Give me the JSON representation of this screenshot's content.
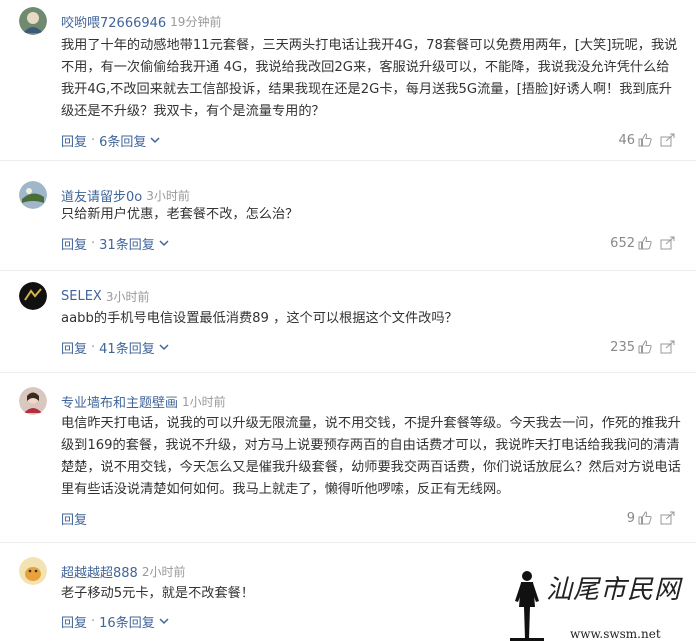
{
  "comments": [
    {
      "user": "咬哟喂72666946",
      "time": "19分钟前",
      "text": "我用了十年的动感地带11元套餐，三天两头打电话让我开4G，78套餐可以免费用两年，[大笑]玩呢，我说不用，有一次偷偷给我开通 4G，我说给我改回2G来，客服说升级可以，不能降，我说我没允许凭什么给我开4G,不改回来就去工信部投诉，结果我现在还是2G卡，每月送我5G流量，[捂脸]好诱人啊！我到底升级还是不升级？我双卡，有个是流量专用的？",
      "reply": "回复",
      "replies": "6条回复",
      "likes": "46"
    },
    {
      "user": "道友请留步0o",
      "time": "3小时前",
      "text": "只给新用户优惠，老套餐不改，怎么治？",
      "reply": "回复",
      "replies": "31条回复",
      "likes": "652"
    },
    {
      "user": "SELEX",
      "time": "3小时前",
      "text": "aabb的手机号电信设置最低消费89 ，这个可以根据这个文件改吗？",
      "reply": "回复",
      "replies": "41条回复",
      "likes": "235"
    },
    {
      "user": "专业墙布和主题壁画",
      "time": "1小时前",
      "text": "电信昨天打电话，说我的可以升级无限流量，说不用交钱，不提升套餐等级。今天我去一问，作死的推我升级到169的套餐，我说不升级，对方马上说要预存两百的自由话费才可以，我说昨天打电话给我我问的清清楚楚，说不用交钱，今天怎么又是催我升级套餐，幼师要我交两百话费，你们说话放屁么？然后对方说电话里有些话没说清楚如何如何。我马上就走了，懒得听他啰嗦，反正有无线网。",
      "reply": "回复",
      "replies": "",
      "likes": "9"
    },
    {
      "user": "超越越超888",
      "time": "2小时前",
      "text": "老子移动5元卡，就是不改套餐！",
      "reply": "回复",
      "replies": "16条回复",
      "likes": ""
    }
  ],
  "watermark": {
    "title": "汕尾市民网",
    "url": "www.swsm.net"
  },
  "colors": {
    "link": "#406599",
    "meta": "#999999",
    "text": "#333333"
  }
}
